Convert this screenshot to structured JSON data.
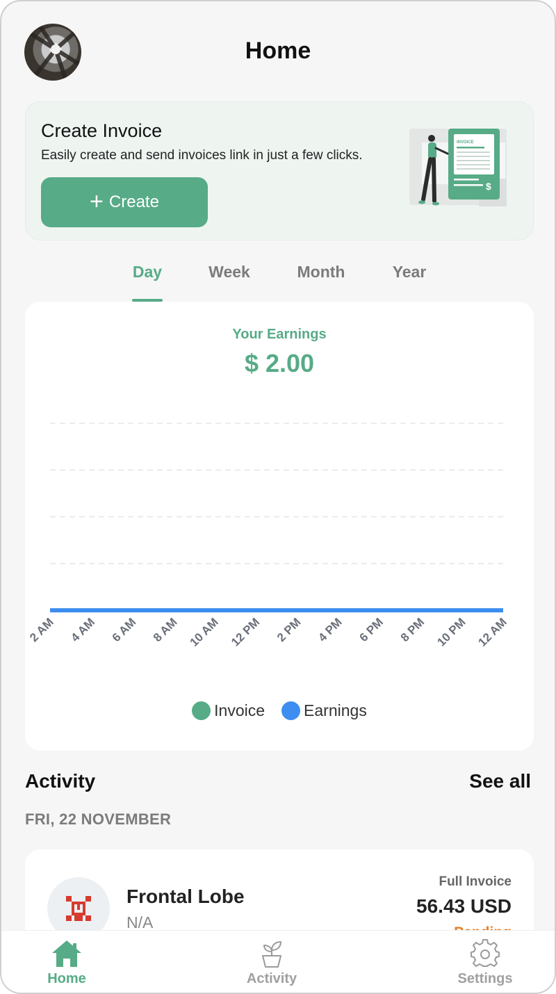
{
  "header": {
    "title": "Home",
    "avatar_icon": "avatar-photo"
  },
  "invoice_card": {
    "title": "Create Invoice",
    "description": "Easily create and send invoices link in just a few clicks.",
    "create_label": "Create",
    "create_icon": "plus-icon",
    "illustration_label": "INVOICE",
    "illustration_currency": "$"
  },
  "tabs": [
    {
      "label": "Day",
      "active": true
    },
    {
      "label": "Week",
      "active": false
    },
    {
      "label": "Month",
      "active": false
    },
    {
      "label": "Year",
      "active": false
    }
  ],
  "earnings": {
    "label": "Your Earnings",
    "value": "$ 2.00"
  },
  "chart_data": {
    "type": "line",
    "x": [
      "2 AM",
      "4 AM",
      "6 AM",
      "8 AM",
      "10 AM",
      "12 PM",
      "2 PM",
      "4 PM",
      "6 PM",
      "8 PM",
      "10 PM",
      "12 AM"
    ],
    "series": [
      {
        "name": "Invoice",
        "color": "#57ab87",
        "values": [
          0,
          0,
          0,
          0,
          0,
          0,
          0,
          0,
          0,
          0,
          0,
          0
        ]
      },
      {
        "name": "Earnings",
        "color": "#3d8ef0",
        "values": [
          0,
          0,
          0,
          0,
          0,
          0,
          0,
          0,
          0,
          0,
          0,
          0
        ]
      }
    ],
    "grid": true,
    "grid_style": "dashed",
    "legend": "bottom"
  },
  "activity": {
    "heading": "Activity",
    "see_all": "See all",
    "date": "FRI, 22 NOVEMBER",
    "items": [
      {
        "name": "Frontal Lobe",
        "subtitle": "N/A",
        "type": "Full Invoice",
        "amount": "56.43 USD",
        "status": "Pending",
        "icon": "pixel-logo-icon"
      }
    ]
  },
  "bottom_nav": [
    {
      "label": "Home",
      "icon": "home-icon",
      "active": true
    },
    {
      "label": "Activity",
      "icon": "plant-icon",
      "active": false
    },
    {
      "label": "Settings",
      "icon": "gear-icon",
      "active": false
    }
  ],
  "colors": {
    "brand": "#57ab87",
    "earnings_line": "#3d8ef0",
    "pending": "#e67e22"
  }
}
